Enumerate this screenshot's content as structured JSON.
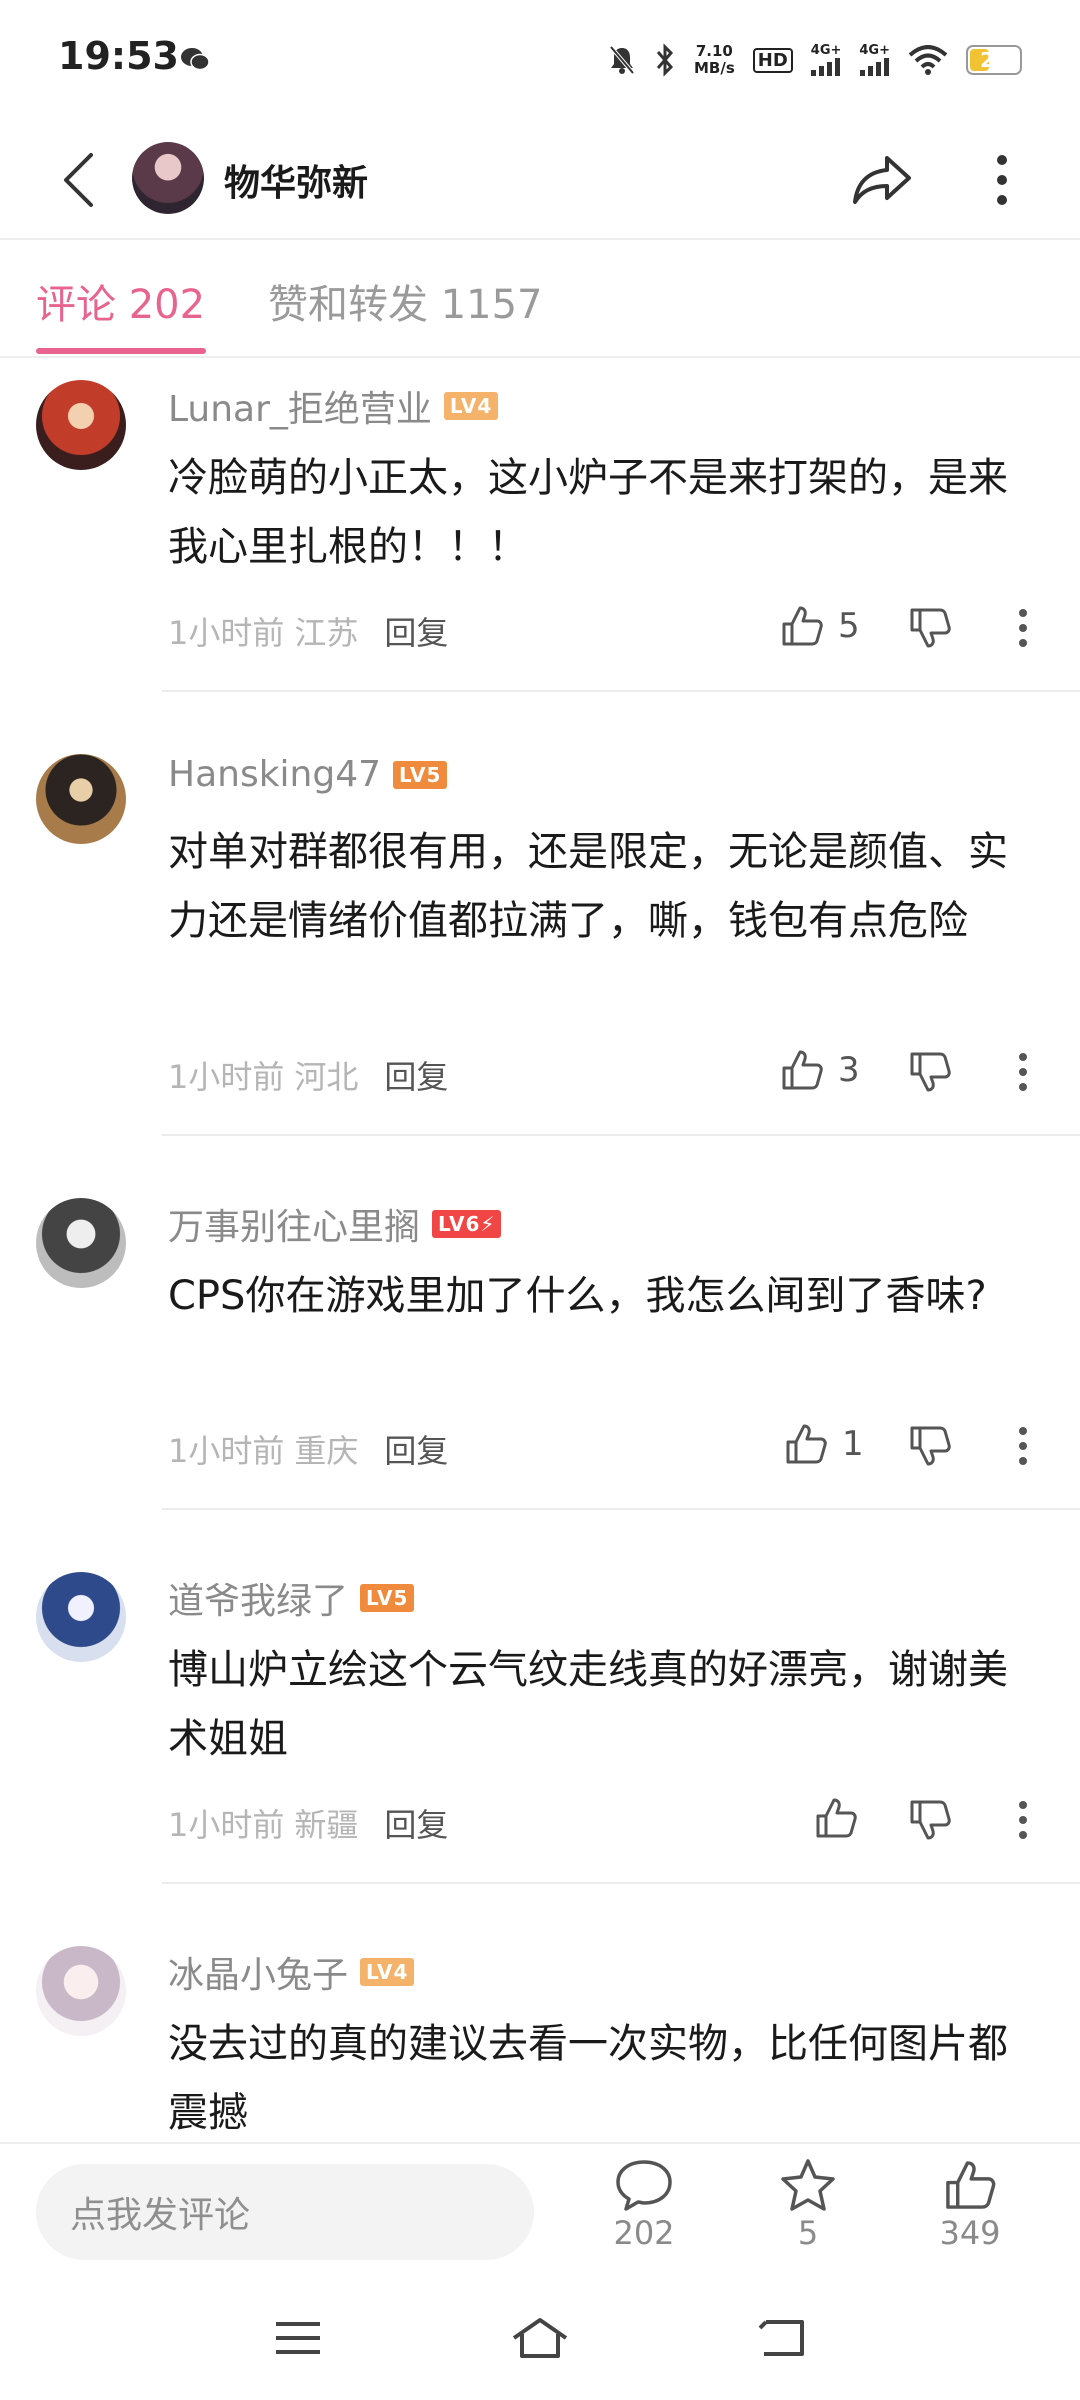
{
  "status_bar": {
    "time": "19:53",
    "net_speed_value": "7.10",
    "net_speed_unit": "MB/s",
    "hd_label": "HD",
    "signal1": "4G+",
    "signal2": "4G+",
    "battery": "21"
  },
  "header": {
    "title": "物华弥新",
    "icons": [
      "back-icon",
      "share-icon",
      "more-icon"
    ]
  },
  "tabs": {
    "comments": "评论 202",
    "likes_reposts": "赞和转发 1157"
  },
  "comments": [
    {
      "user": "Lunar_拒绝营业",
      "level": "LV4",
      "level_color": "#f5b26b",
      "text": "冷脸萌的小正太，这小炉子不是来打架的，是来我心里扎根的！！！",
      "time": "1小时前",
      "location": "江苏",
      "reply": "回复",
      "likes": "5"
    },
    {
      "user": "Hansking47",
      "level": "LV5",
      "level_color": "#f08a3c",
      "text": "对单对群都很有用，还是限定，无论是颜值、实力还是情绪价值都拉满了，嘶，钱包有点危险",
      "time": "1小时前",
      "location": "河北",
      "reply": "回复",
      "likes": "3"
    },
    {
      "user": "万事别往心里搁",
      "level": "LV6⚡",
      "level_color": "#f04646",
      "text": "CPS你在游戏里加了什么，我怎么闻到了香味?",
      "time": "1小时前",
      "location": "重庆",
      "reply": "回复",
      "likes": "1"
    },
    {
      "user": "道爷我绿了",
      "level": "LV5",
      "level_color": "#f08a3c",
      "text": "博山炉立绘这个云气纹走线真的好漂亮，谢谢美术姐姐",
      "time": "1小时前",
      "location": "新疆",
      "reply": "回复",
      "likes": ""
    },
    {
      "user": "冰晶小兔子",
      "level": "LV4",
      "level_color": "#f5b26b",
      "text": "没去过的真的建议去看一次实物，比任何图片都震撼",
      "time": "",
      "location": "",
      "reply": "",
      "likes": ""
    }
  ],
  "bottom_bar": {
    "input_placeholder": "点我发评论",
    "comment_count": "202",
    "favorite_count": "5",
    "like_count": "349"
  },
  "nav_bar": {
    "icons": [
      "menu-icon",
      "home-icon",
      "back-nav-icon"
    ]
  },
  "colors": {
    "accent": "#e8648f",
    "text_secondary": "#8a8a8a"
  }
}
